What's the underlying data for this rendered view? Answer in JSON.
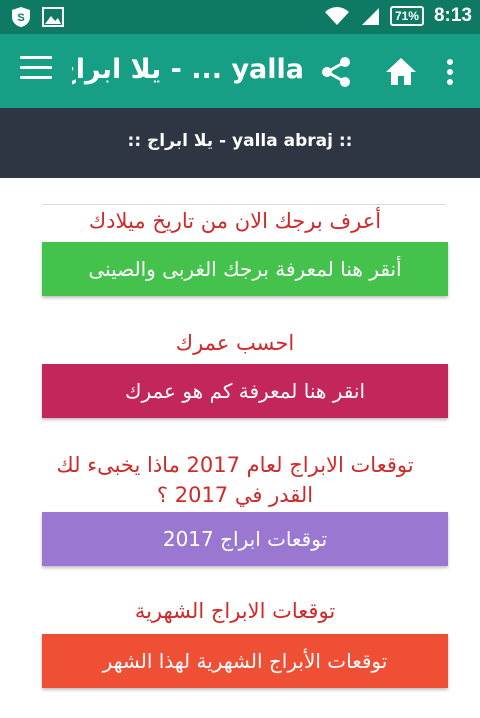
{
  "status_bar": {
    "time": "8:13",
    "battery": "71%"
  },
  "app_bar": {
    "title": "yalla ... - يلا ابراج"
  },
  "sub_header": {
    "title": ":: yalla abraj - يلا ابراج ::"
  },
  "sections": [
    {
      "heading": "أعرف برجك الان من تاريخ ميلادك",
      "button_label": "أنقر هنا لمعرفة برجك الغربى والصينى",
      "button_color": "#45c24b"
    },
    {
      "heading": "احسب عمرك",
      "button_label": "انقر هنا لمعرفة كم هو عمرك",
      "button_color": "#c2265a"
    },
    {
      "heading_line1": "توقعات الابراج لعام 2017 ماذا يخبىء لك",
      "heading_line2": "القدر في 2017 ؟",
      "button_label": "توقعات ابراج 2017",
      "button_color": "#9a78d2"
    },
    {
      "heading": "توقعات الابراج الشهرية",
      "button_label": "توقعات الأبراج الشهرية لهذا الشهر",
      "button_color": "#ef4f34"
    }
  ],
  "colors": {
    "status_bar": "#0e7a63",
    "app_bar": "#169f85",
    "sub_header": "#2d3642",
    "heading_text": "#cf2a2a",
    "left_accent": "#8e55b8"
  }
}
